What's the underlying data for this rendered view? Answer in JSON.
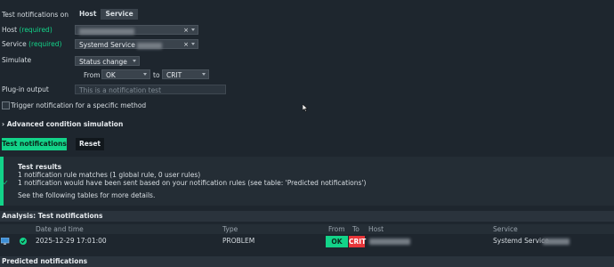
{
  "form": {
    "test_notifications_on_label": "Test notifications on",
    "toggle_host": "Host",
    "toggle_service": "Service",
    "host_label": "Host",
    "host_required": "(required)",
    "service_label": "Service",
    "service_required": "(required)",
    "service_value": "Systemd Service",
    "simulate_label": "Simulate",
    "simulate_value": "Status change",
    "from_label": "From",
    "from_value": "OK",
    "to_label": "to",
    "to_value": "CRIT",
    "plugin_output_label": "Plug-in output",
    "plugin_output_placeholder": "This is a notification test",
    "trigger_checkbox_label": "Trigger notification for a specific method",
    "advanced_label": "Advanced condition simulation",
    "test_button": "Test notifications",
    "reset_button": "Reset"
  },
  "results": {
    "title": "Test results",
    "line1": "1 notification rule matches (1 global rule, 0 user rules)",
    "line2": "1 notification would have been sent based on your notification rules (see table: 'Predicted notifications')",
    "line3": "See the following tables for more details."
  },
  "analysis": {
    "title": "Analysis: Test notifications",
    "columns": [
      "Date and time",
      "Type",
      "From",
      "To",
      "Host",
      "Service"
    ],
    "row": {
      "datetime": "2025-12-29 17:01:00",
      "type": "PROBLEM",
      "from": "OK",
      "to": "CRIT",
      "service": "Systemd Service"
    }
  },
  "predicted": {
    "title": "Predicted notifications"
  },
  "colors": {
    "accent": "#13d389",
    "crit": "#e8363a",
    "background": "#1e262e"
  }
}
